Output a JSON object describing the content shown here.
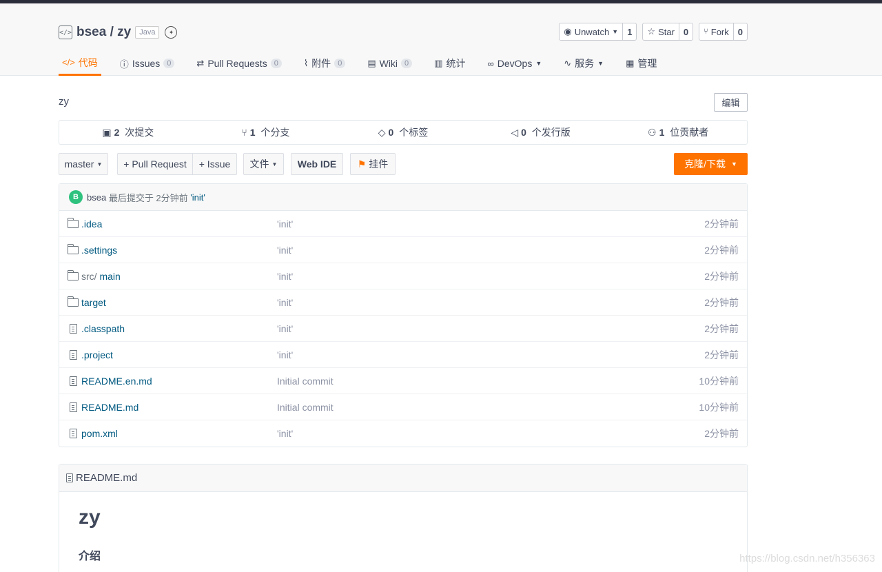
{
  "repo": {
    "owner": "bsea",
    "separator": " / ",
    "name": "zy",
    "language": "Java",
    "description": "zy"
  },
  "actions": [
    {
      "label": "Unwatch",
      "count": "1",
      "icon": "eye-icon",
      "dropdown": true
    },
    {
      "label": "Star",
      "count": "0",
      "icon": "star-icon"
    },
    {
      "label": "Fork",
      "count": "0",
      "icon": "fork-icon"
    }
  ],
  "tabs": [
    {
      "label": "代码",
      "icon": "code-icon",
      "active": true
    },
    {
      "label": "Issues",
      "badge": "0",
      "icon": "issue-icon"
    },
    {
      "label": "Pull Requests",
      "badge": "0",
      "icon": "pull-request-icon"
    },
    {
      "label": "附件",
      "badge": "0",
      "icon": "attachment-icon"
    },
    {
      "label": "Wiki",
      "badge": "0",
      "icon": "wiki-icon"
    },
    {
      "label": "统计",
      "icon": "chart-icon"
    },
    {
      "label": "DevOps",
      "icon": "infinity-icon",
      "dropdown": true
    },
    {
      "label": "服务",
      "icon": "pulse-icon",
      "dropdown": true
    },
    {
      "label": "管理",
      "icon": "settings-doc-icon"
    }
  ],
  "edit_label": "编辑",
  "stats": [
    {
      "num": "2",
      "label": " 次提交",
      "icon": "commit-icon"
    },
    {
      "num": "1",
      "label": " 个分支",
      "icon": "branch-icon"
    },
    {
      "num": "0",
      "label": " 个标签",
      "icon": "tag-icon"
    },
    {
      "num": "0",
      "label": " 个发行版",
      "icon": "release-icon"
    },
    {
      "num": "1",
      "label": " 位贡献者",
      "icon": "contributors-icon"
    }
  ],
  "toolbar": {
    "branch": "master",
    "pull_request": "+ Pull Request",
    "issue": "+ Issue",
    "file": "文件",
    "webide": "Web IDE",
    "plugin": "挂件",
    "clone": "克隆/下载"
  },
  "last_commit": {
    "avatar_letter": "B",
    "author": "bsea",
    "text": " 最后提交于 2分钟前 ",
    "message": "'init'"
  },
  "files": [
    {
      "type": "folder",
      "name": ".idea",
      "msg": "'init'",
      "time": "2分钟前"
    },
    {
      "type": "folder",
      "name": ".settings",
      "msg": "'init'",
      "time": "2分钟前"
    },
    {
      "type": "folder",
      "prefix": "src/ ",
      "name": "main",
      "msg": "'init'",
      "time": "2分钟前"
    },
    {
      "type": "folder",
      "name": "target",
      "msg": "'init'",
      "time": "2分钟前"
    },
    {
      "type": "file",
      "name": ".classpath",
      "msg": "'init'",
      "time": "2分钟前"
    },
    {
      "type": "file",
      "name": ".project",
      "msg": "'init'",
      "time": "2分钟前"
    },
    {
      "type": "file",
      "name": "README.en.md",
      "msg": "Initial commit",
      "time": "10分钟前"
    },
    {
      "type": "file",
      "name": "README.md",
      "msg": "Initial commit",
      "time": "10分钟前"
    },
    {
      "type": "file",
      "name": "pom.xml",
      "msg": "'init'",
      "time": "2分钟前"
    }
  ],
  "readme": {
    "filename": "README.md",
    "h1": "zy",
    "h3": "介绍"
  },
  "watermark": "https://blog.csdn.net/h356363",
  "colors": {
    "accent": "#fe7300",
    "link": "#005980",
    "avatar": "#2ec27e"
  }
}
